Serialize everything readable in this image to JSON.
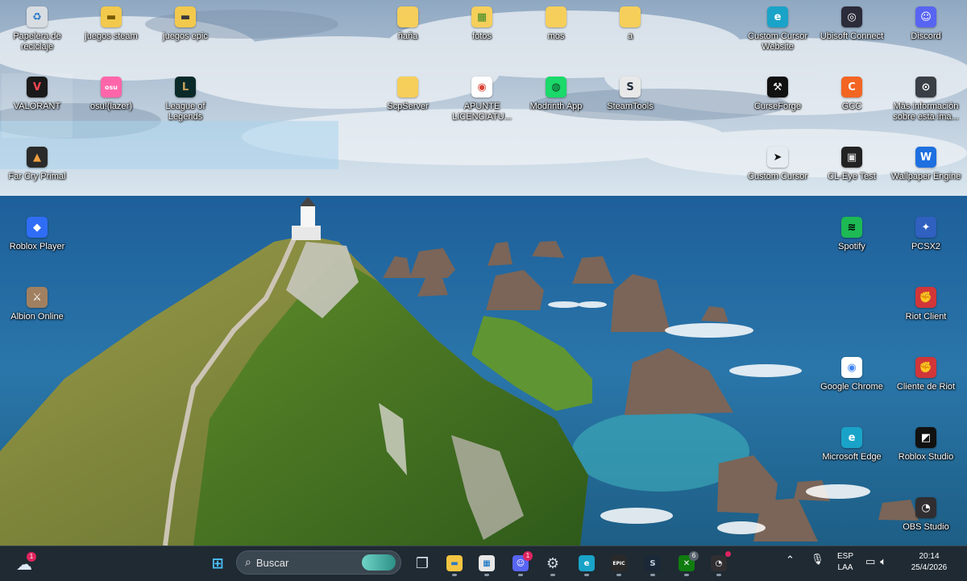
{
  "desktop": {
    "icons": [
      {
        "id": "recycle",
        "label": "Papelera de reciclaje",
        "icon": "recycle-bin-icon",
        "glyph": "♻",
        "bg": "#d8dde2",
        "fg": "#2b78c5"
      },
      {
        "id": "juegos-steam",
        "label": "juegos steam",
        "icon": "folder-icon",
        "glyph": "▬",
        "bg": "#f2c94c",
        "fg": "#7a5a00"
      },
      {
        "id": "juegos-epic",
        "label": "juegos epic",
        "icon": "folder-icon",
        "glyph": "▬",
        "bg": "#f2c94c",
        "fg": "#3a3a3a"
      },
      {
        "id": "nana",
        "label": "ñaña",
        "icon": "folder-icon",
        "glyph": "",
        "bg": "#f5cf5a",
        "fg": "#fff"
      },
      {
        "id": "fotos",
        "label": "fotos",
        "icon": "folder-icon",
        "glyph": "▦",
        "bg": "#f5cf5a",
        "fg": "#3b8a2a"
      },
      {
        "id": "mos",
        "label": "mos",
        "icon": "folder-icon",
        "glyph": "",
        "bg": "#f5cf5a",
        "fg": "#fff"
      },
      {
        "id": "a",
        "label": "a",
        "icon": "folder-icon",
        "glyph": "",
        "bg": "#f5cf5a",
        "fg": "#fff"
      },
      {
        "id": "custom-cursor-web",
        "label": "Custom Cursor Website",
        "icon": "edge-icon",
        "glyph": "e",
        "bg": "#1aa3c8",
        "fg": "#fff"
      },
      {
        "id": "ubisoft",
        "label": "Ubisoft Connect",
        "icon": "ubisoft-icon",
        "glyph": "◎",
        "bg": "#2b2b3a",
        "fg": "#fff"
      },
      {
        "id": "discord",
        "label": "Discord",
        "icon": "discord-icon",
        "glyph": "☺",
        "bg": "#5865f2",
        "fg": "#fff"
      },
      {
        "id": "valorant",
        "label": "VALORANT",
        "icon": "valorant-icon",
        "glyph": "V",
        "bg": "#1a1a1a",
        "fg": "#ff4655"
      },
      {
        "id": "osu",
        "label": "osu!(lazer)",
        "icon": "osu-icon",
        "glyph": "osu",
        "bg": "#ff66aa",
        "fg": "#fff"
      },
      {
        "id": "league",
        "label": "League of Legends",
        "icon": "league-icon",
        "glyph": "L",
        "bg": "#0a2a2a",
        "fg": "#c8a45a"
      },
      {
        "id": "scpserver",
        "label": "ScpServer",
        "icon": "folder-icon",
        "glyph": "",
        "bg": "#f5cf5a",
        "fg": "#fff"
      },
      {
        "id": "apunte",
        "label": "APUNTE LICENCIATU...",
        "icon": "chrome-icon",
        "glyph": "◉",
        "bg": "#ffffff",
        "fg": "#db4437"
      },
      {
        "id": "modrinth",
        "label": "Modrinth App",
        "icon": "modrinth-icon",
        "glyph": "◍",
        "bg": "#1bd96a",
        "fg": "#0d3b1f"
      },
      {
        "id": "steamtools",
        "label": "SteamTools",
        "icon": "steam-icon",
        "glyph": "S",
        "bg": "#e8e8e8",
        "fg": "#1b2838"
      },
      {
        "id": "curseforge",
        "label": "CurseForge",
        "icon": "curseforge-icon",
        "glyph": "⚒",
        "bg": "#111111",
        "fg": "#fff"
      },
      {
        "id": "gcc",
        "label": "GCC",
        "icon": "gcc-icon",
        "glyph": "C",
        "bg": "#f26522",
        "fg": "#fff"
      },
      {
        "id": "mas-info",
        "label": "Más información sobre esta ima...",
        "icon": "info-camera-icon",
        "glyph": "⊙",
        "bg": "#3a3f45",
        "fg": "#fff"
      },
      {
        "id": "farcry",
        "label": "Far Cry Primal",
        "icon": "farcry-icon",
        "glyph": "▲",
        "bg": "#2a2a2a",
        "fg": "#f0a040"
      },
      {
        "id": "custom-cursor",
        "label": "Custom Cursor",
        "icon": "cursor-icon",
        "glyph": "➤",
        "bg": "transparent",
        "fg": "#111"
      },
      {
        "id": "cl-eye",
        "label": "CL-Eye Test",
        "icon": "camera-icon",
        "glyph": "▣",
        "bg": "#222",
        "fg": "#ddd"
      },
      {
        "id": "wallpaper-engine",
        "label": "Wallpaper Engine",
        "icon": "wallpaper-engine-icon",
        "glyph": "W",
        "bg": "#1e6fe0",
        "fg": "#fff"
      },
      {
        "id": "roblox-player",
        "label": "Roblox Player",
        "icon": "roblox-icon",
        "glyph": "◆",
        "bg": "#2f6df6",
        "fg": "#fff"
      },
      {
        "id": "spotify",
        "label": "Spotify",
        "icon": "spotify-icon",
        "glyph": "≋",
        "bg": "#1db954",
        "fg": "#000"
      },
      {
        "id": "pcsx2",
        "label": "PCSX2",
        "icon": "pcsx2-icon",
        "glyph": "✦",
        "bg": "#3060c0",
        "fg": "#fff"
      },
      {
        "id": "albion",
        "label": "Albion Online",
        "icon": "albion-icon",
        "glyph": "⚔",
        "bg": "#a08060",
        "fg": "#fff"
      },
      {
        "id": "riot-client",
        "label": "Riot Client",
        "icon": "riot-icon",
        "glyph": "✊",
        "bg": "#d13639",
        "fg": "#fff"
      },
      {
        "id": "chrome",
        "label": "Google Chrome",
        "icon": "chrome-icon",
        "glyph": "◉",
        "bg": "#ffffff",
        "fg": "#4285f4"
      },
      {
        "id": "cliente-riot",
        "label": "Cliente de Riot",
        "icon": "riot-icon",
        "glyph": "✊",
        "bg": "#d13639",
        "fg": "#fff"
      },
      {
        "id": "edge",
        "label": "Microsoft Edge",
        "icon": "edge-icon",
        "glyph": "e",
        "bg": "#1aa3c8",
        "fg": "#fff"
      },
      {
        "id": "roblox-studio",
        "label": "Roblox Studio",
        "icon": "roblox-studio-icon",
        "glyph": "◩",
        "bg": "#111",
        "fg": "#fff"
      },
      {
        "id": "obs",
        "label": "OBS Studio",
        "icon": "obs-icon",
        "glyph": "◔",
        "bg": "#302e31",
        "fg": "#fff"
      }
    ]
  },
  "taskbar": {
    "search_label": "Buscar",
    "weather_badge": "1",
    "discord_badge": "1",
    "xbox_badge": "6",
    "apps": [
      {
        "name": "start-button",
        "icon": "windows-start-icon",
        "glyph": "⊞",
        "bg": "transparent",
        "fg": "#4cc2ff"
      },
      {
        "name": "task-view-button",
        "icon": "task-view-icon",
        "glyph": "❐",
        "bg": "transparent",
        "fg": "#dfe6ec"
      },
      {
        "name": "file-explorer-button",
        "icon": "folder-icon",
        "glyph": "▬",
        "bg": "#f5c542",
        "fg": "#2b78c5"
      },
      {
        "name": "microsoft-store-button",
        "icon": "store-icon",
        "glyph": "▦",
        "bg": "#e8e8e8",
        "fg": "#0067c0"
      },
      {
        "name": "discord-taskbar-button",
        "icon": "discord-icon",
        "glyph": "☺",
        "bg": "#5865f2",
        "fg": "#fff"
      },
      {
        "name": "settings-button",
        "icon": "gear-icon",
        "glyph": "⚙",
        "bg": "transparent",
        "fg": "#cfd6dc"
      },
      {
        "name": "edge-taskbar-button",
        "icon": "edge-icon",
        "glyph": "e",
        "bg": "#1aa3c8",
        "fg": "#fff"
      },
      {
        "name": "epic-games-button",
        "icon": "epic-games-icon",
        "glyph": "EPIC",
        "bg": "#2a2a2a",
        "fg": "#fff"
      },
      {
        "name": "steam-taskbar-button",
        "icon": "steam-icon",
        "glyph": "S",
        "bg": "#1b2838",
        "fg": "#c7d5e0"
      },
      {
        "name": "xbox-button",
        "icon": "xbox-icon",
        "glyph": "✕",
        "bg": "#107c10",
        "fg": "#fff"
      },
      {
        "name": "obs-taskbar-button",
        "icon": "obs-icon",
        "glyph": "◔",
        "bg": "#302e31",
        "fg": "#fff"
      }
    ],
    "tray": {
      "language_line1": "ESP",
      "language_line2": "LAA",
      "time": "20:14",
      "date": "25/4/2026"
    }
  }
}
